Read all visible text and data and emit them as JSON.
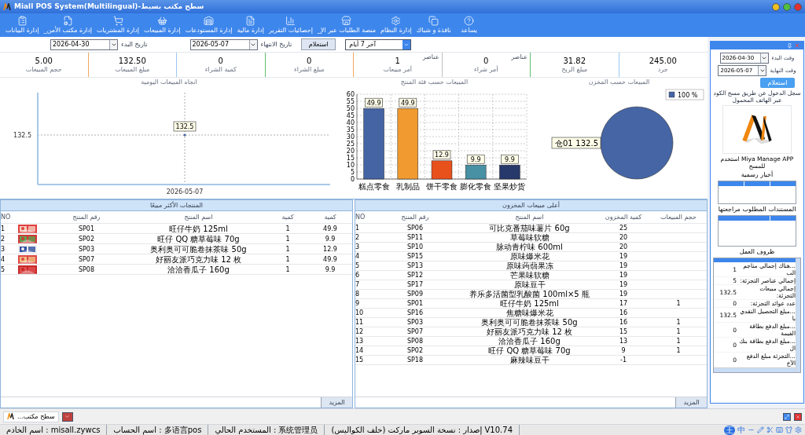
{
  "window": {
    "title": "Miall POS System(Multilingual)-سطح مكتب بسيط"
  },
  "toolbar": [
    {
      "label": "يساعد"
    },
    {
      "label": "نافذة و شباك"
    },
    {
      "label": "إدارة النظام"
    },
    {
      "label": "_منصة الطلبات عبر الإ"
    },
    {
      "label": "إحصائيات التقرير"
    },
    {
      "label": "إدارة مالية"
    },
    {
      "label": "إدارة المستودعات"
    },
    {
      "label": "إدارة المبيعات"
    },
    {
      "label": "إدارة المشتريات"
    },
    {
      "label": "_إدارة مكتب الأمن"
    },
    {
      "label": "إدارة البيانات"
    }
  ],
  "filters": {
    "start_label": "تاريخ البدء",
    "start_date": "2026-04-30",
    "end_label": "تاريخ الانتهاء",
    "end_date": "2026-05-07",
    "query_button": "استعلام",
    "period": "آخر 7 أيام"
  },
  "kpis": [
    {
      "value": "245.00",
      "label": "جرد"
    },
    {
      "value": "31.82",
      "label": "مبلغ الربح"
    },
    {
      "value": "0",
      "label": "أمر شراء",
      "badge": "عناصر"
    },
    {
      "value": "1",
      "label": "أمر مبيعات",
      "badge": "عناصر"
    },
    {
      "value": "0",
      "label": "مبلغ الشراء"
    },
    {
      "value": "0",
      "label": "كمية الشراء"
    },
    {
      "value": "132.50",
      "label": "مبلغ المبيعات"
    },
    {
      "value": "5.00",
      "label": "حجم المبيعات"
    }
  ],
  "daily_chart": {
    "title": "اتجاه المبيعات اليومية",
    "y_label": "132.5",
    "x_label": "2026-05-07",
    "point_label": "132.5"
  },
  "category_chart": {
    "chart_data": {
      "type": "bar",
      "title": "المبيعات حسب فئة المنتج",
      "categories": [
        "糕点零食",
        "乳制品",
        "饼干零食",
        "膨化零食",
        "坚果炒货"
      ],
      "values": [
        49.9,
        49.9,
        12.9,
        9.9,
        9.9
      ],
      "colors": [
        "#4464a4",
        "#f09a30",
        "#e8501c",
        "#4890a4",
        "#27386a"
      ],
      "ylim": [
        0,
        60
      ],
      "yticks": [
        0,
        5,
        10,
        15,
        20,
        25,
        30,
        35,
        40,
        45,
        50,
        55,
        60
      ],
      "grid": true,
      "data_labels": true
    }
  },
  "warehouse_chart": {
    "legend_label": "100 %",
    "chart_data": {
      "type": "pie",
      "title": "المبيعات حسب المخزن",
      "categories": [
        "仓01"
      ],
      "values": [
        132.5
      ],
      "colors": [
        "#4565a5"
      ],
      "data_labels": true
    }
  },
  "top_products": {
    "title": "المنتجات الأكثر مبيعًا",
    "columns": [
      "كمية",
      "كمية",
      "اسم المنتج",
      "رقم المنتج",
      "NO"
    ],
    "more_button": "المزيد",
    "rows": [
      {
        "no": "1",
        "code": "SP01",
        "name": "旺仔牛奶 125ml",
        "qty": "1",
        "amount": "49.9"
      },
      {
        "no": "2",
        "code": "SP02",
        "name": "旺仔 QQ 糖草莓味 70g",
        "qty": "1",
        "amount": "9.9"
      },
      {
        "no": "3",
        "code": "SP03",
        "name": "奥利奥可可脆卷抹茶味 50g",
        "qty": "1",
        "amount": "12.9"
      },
      {
        "no": "4",
        "code": "SP07",
        "name": "好丽友派巧克力味 12 枚",
        "qty": "1",
        "amount": "49.9"
      },
      {
        "no": "5",
        "code": "SP08",
        "name": "洽洽香瓜子 160g",
        "qty": "1",
        "amount": "9.9"
      }
    ]
  },
  "stock": {
    "title": "أعلى مبيعات المخزون",
    "columns": [
      "حجم المبيعات",
      "كمية المخزون",
      "اسم المنتج",
      "رقم المنتج",
      "NO"
    ],
    "more_button": "المزيد",
    "rows": [
      {
        "no": "1",
        "code": "SP06",
        "name": "可比克番茄味薯片 60g",
        "stock": "25"
      },
      {
        "no": "2",
        "code": "SP11",
        "name": "草莓味软糖",
        "stock": "20"
      },
      {
        "no": "3",
        "code": "SP10",
        "name": "脉动青柠味 600ml",
        "stock": "20"
      },
      {
        "no": "4",
        "code": "SP15",
        "name": "原味爆米花",
        "stock": "19"
      },
      {
        "no": "5",
        "code": "SP13",
        "name": "原味蒟蒻果冻",
        "stock": "19"
      },
      {
        "no": "6",
        "code": "SP12",
        "name": "芒果味软糖",
        "stock": "19"
      },
      {
        "no": "7",
        "code": "SP17",
        "name": "原味豆干",
        "stock": "19"
      },
      {
        "no": "8",
        "code": "SP09",
        "name": "养乐多活菌型乳酸菌 100ml×5 瓶",
        "stock": "19"
      },
      {
        "no": "9",
        "code": "SP01",
        "name": "旺仔牛奶 125ml",
        "stock": "17",
        "sales": "1"
      },
      {
        "no": "10",
        "code": "SP16",
        "name": "焦糖味爆米花",
        "stock": "16"
      },
      {
        "no": "11",
        "code": "SP03",
        "name": "奥利奥可可脆卷抹茶味 50g",
        "stock": "16",
        "sales": "1"
      },
      {
        "no": "12",
        "code": "SP07",
        "name": "好丽友派巧克力味 12 枚",
        "stock": "15",
        "sales": "1"
      },
      {
        "no": "13",
        "code": "SP08",
        "name": "洽洽香瓜子 160g",
        "stock": "13",
        "sales": "1"
      },
      {
        "no": "14",
        "code": "SP02",
        "name": "旺仔 QQ 糖草莓味 70g",
        "stock": "9",
        "sales": "1"
      },
      {
        "no": "15",
        "code": "SP18",
        "name": "麻辣味豆干",
        "stock": "-1"
      }
    ]
  },
  "sidebar": {
    "start_label": "وقت البدء",
    "start_date": "2026-04-30",
    "end_label": "وقت النهاية",
    "end_date": "2026-05-07",
    "query_button": "استعلام",
    "login_hint": "سجل الدخول عن طريق مسح الكود عبر الهاتف المحمول",
    "app_hint": "استخدم Miya Manage APP للمسح",
    "news_title": "أخبار رسمية",
    "docs_title": "المستندات المطلوب مراجعتها",
    "work_title": "ظروف العمل",
    "work_items": [
      {
        "label": "...هناك إجمالي مناجم الب",
        "value": "1"
      },
      {
        "label": "إجمالي عناصر التجزئة:",
        "value": "5"
      },
      {
        "label": "إجمالي مبيعات التجزئة:",
        "value": "132.5"
      },
      {
        "label": "عدد عوائد التجزئة:",
        "value": "0"
      },
      {
        "label": "...مبلغ التحصيل النقدي با",
        "value": "132.5"
      },
      {
        "label": "...مبلغ الدفع بطاقة القيمة",
        "value": "0"
      },
      {
        "label": "...مبلغ الدفع بطاقة بنك ال",
        "value": "0"
      },
      {
        "label": "...التجزئة مبلغ الدفع الآخ",
        "value": "0"
      }
    ]
  },
  "taskbar": {
    "item": "...سطح مكتب"
  },
  "status_bar": [
    "إصدار : نسخة السوبر ماركت (خلف الكواليس) V10.74",
    "المستخدم الحالي : 系统管理员",
    "اسم الحساب : 多语言pos",
    "اسم الخادم : misall.zywcs"
  ],
  "ime_bar": [
    "中",
    "王"
  ]
}
